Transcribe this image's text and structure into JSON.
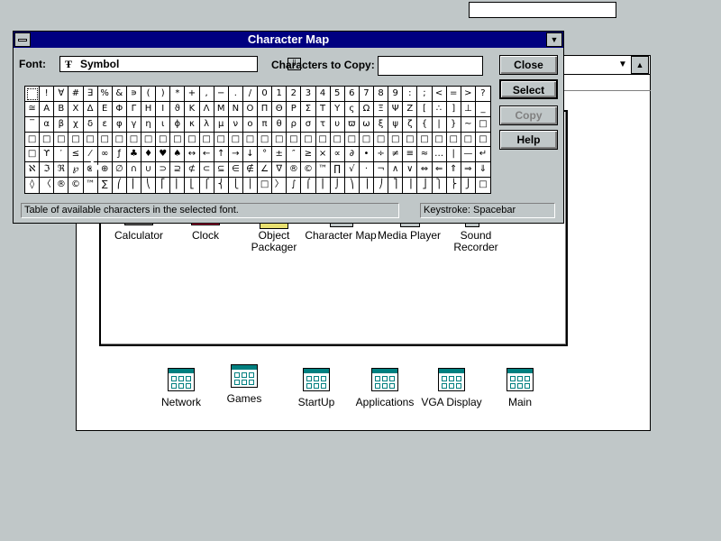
{
  "charmap": {
    "title": "Character Map",
    "font_label": "Font:",
    "font_value": "Symbol",
    "font_icon": "truetype-icon",
    "copy_label": "Characters to Copy:",
    "copy_value": "",
    "buttons": {
      "close": "Close",
      "select": "Select",
      "copy": "Copy",
      "help": "Help"
    },
    "status_text": "Table of available characters in the selected font.",
    "keystroke_text": "Keystroke: Spacebar",
    "rows": [
      [
        " ",
        "!",
        "∀",
        "#",
        "∃",
        "%",
        "&",
        "∍",
        "(",
        ")",
        "*",
        "+",
        ",",
        "−",
        ".",
        "/",
        "0",
        "1",
        "2",
        "3",
        "4",
        "5",
        "6",
        "7",
        "8",
        "9",
        ":",
        ";",
        "<",
        "=",
        ">",
        "?"
      ],
      [
        "≅",
        "Α",
        "Β",
        "Χ",
        "Δ",
        "Ε",
        "Φ",
        "Γ",
        "Η",
        "Ι",
        "ϑ",
        "Κ",
        "Λ",
        "Μ",
        "Ν",
        "Ο",
        "Π",
        "Θ",
        "Ρ",
        "Σ",
        "Τ",
        "Υ",
        "ς",
        "Ω",
        "Ξ",
        "Ψ",
        "Ζ",
        "[",
        "∴",
        "]",
        "⊥",
        "_"
      ],
      [
        "‾",
        "α",
        "β",
        "χ",
        "δ",
        "ε",
        "φ",
        "γ",
        "η",
        "ι",
        "ϕ",
        "κ",
        "λ",
        "μ",
        "ν",
        "ο",
        "π",
        "θ",
        "ρ",
        "σ",
        "τ",
        "υ",
        "ϖ",
        "ω",
        "ξ",
        "ψ",
        "ζ",
        "{",
        "|",
        "}",
        "~",
        "□"
      ],
      [
        "□",
        "□",
        "□",
        "□",
        "□",
        "□",
        "□",
        "□",
        "□",
        "□",
        "□",
        "□",
        "□",
        "□",
        "□",
        "□",
        "□",
        "□",
        "□",
        "□",
        "□",
        "□",
        "□",
        "□",
        "□",
        "□",
        "□",
        "□",
        "□",
        "□",
        "□",
        "□"
      ],
      [
        "□",
        "ϒ",
        "′",
        "≤",
        "⁄",
        "∞",
        "ƒ",
        "♣",
        "♦",
        "♥",
        "♠",
        "↔",
        "←",
        "↑",
        "→",
        "↓",
        "°",
        "±",
        "″",
        "≥",
        "×",
        "∝",
        "∂",
        "•",
        "÷",
        "≠",
        "≡",
        "≈",
        "…",
        "|",
        "—",
        "↵"
      ],
      [
        "ℵ",
        "ℑ",
        "ℜ",
        "℘",
        "⊗",
        "⊕",
        "∅",
        "∩",
        "∪",
        "⊃",
        "⊇",
        "⊄",
        "⊂",
        "⊆",
        "∈",
        "∉",
        "∠",
        "∇",
        "®",
        "©",
        "™",
        "∏",
        "√",
        "·",
        "¬",
        "∧",
        "∨",
        "⇔",
        "⇐",
        "⇑",
        "⇒",
        "⇓"
      ],
      [
        "◊",
        "〈",
        "®",
        "©",
        "™",
        "∑",
        "⎛",
        "⎜",
        "⎝",
        "⎡",
        "⎢",
        "⎣",
        "⎧",
        "⎨",
        "⎩",
        "⎪",
        "□",
        "〉",
        "∫",
        "⌠",
        "⎮",
        "⌡",
        "⎞",
        "⎟",
        "⎠",
        "⎤",
        "⎥",
        "⎦",
        "⎫",
        "⎬",
        "⎭",
        "□"
      ]
    ]
  },
  "program_manager": {
    "accessories_icons": [
      {
        "label": "Calculator",
        "icon": "calculator-icon"
      },
      {
        "label": "Clock",
        "icon": "clock-icon"
      },
      {
        "label": "Object\nPackager",
        "icon": "object-packager-icon"
      },
      {
        "label": "Character Map",
        "icon": "character-map-icon"
      },
      {
        "label": "Media Player",
        "icon": "media-player-icon"
      },
      {
        "label": "Sound\nRecorder",
        "icon": "sound-recorder-icon"
      }
    ],
    "groups": [
      {
        "label": "Network"
      },
      {
        "label": "Games"
      },
      {
        "label": "StartUp"
      },
      {
        "label": "Applications"
      },
      {
        "label": "VGA Display"
      },
      {
        "label": "Main"
      }
    ]
  },
  "colors": {
    "desktop": "#c0c7c8",
    "title_active": "#000080",
    "group_icon_accent": "#008080"
  }
}
